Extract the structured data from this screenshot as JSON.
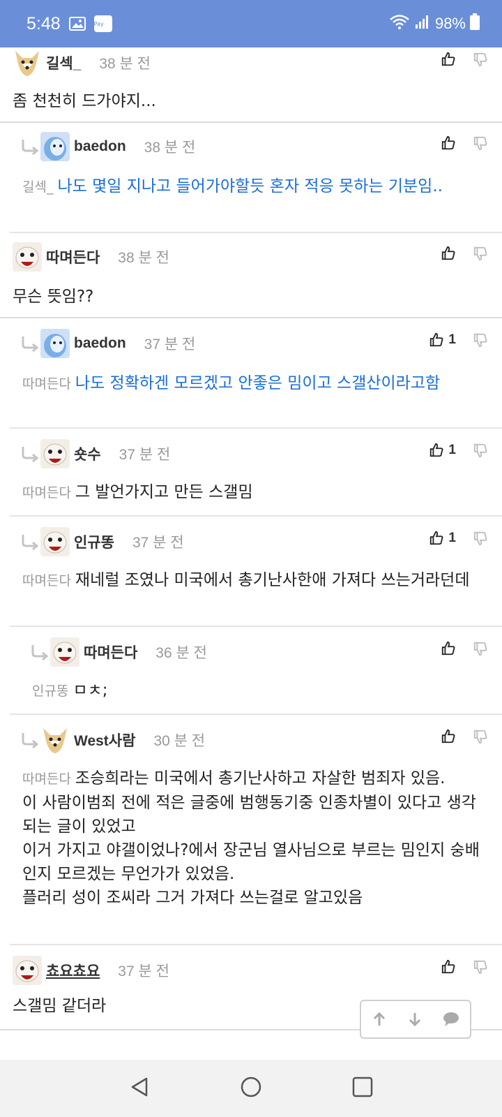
{
  "status_bar": {
    "time": "5:48",
    "pay_badge": "Pay",
    "battery": "98%",
    "bar_color": "#6a8fd8"
  },
  "accent_color": "#1a6ed8",
  "comments": [
    {
      "nick": "길섹_",
      "time": "38 분 전",
      "mention": "",
      "text": "좀 천천히 드가야지...",
      "up": "",
      "avatar": "dog-icon"
    },
    {
      "nick": "baedon",
      "time": "38 분 전",
      "mention": "길섹_",
      "text": "나도 몇일 지나고 들어가야할듯 혼자 적응 못하는 기분임..",
      "up": "",
      "avatar": "blue-face-icon"
    },
    {
      "nick": "따며든다",
      "time": "38 분 전",
      "mention": "",
      "text": "무슨 뜻임??",
      "up": "",
      "avatar": "red-face-icon"
    },
    {
      "nick": "baedon",
      "time": "37 분 전",
      "mention": "따며든다",
      "text": "나도 정확하겐 모르겠고 안좋은 밈이고 스갤산이라고함",
      "up": "1",
      "avatar": "blue-face-icon"
    },
    {
      "nick": "숏수",
      "time": "37 분 전",
      "mention": "따며든다",
      "text": "그 발언가지고 만든 스갤밈",
      "up": "1",
      "avatar": "red-face-icon"
    },
    {
      "nick": "인규똥",
      "time": "37 분 전",
      "mention": "따며든다",
      "text": "재네럴 조였나 미국에서 총기난사한애 가져다 쓰는거라던데",
      "up": "1",
      "avatar": "red-face-icon"
    },
    {
      "nick": "따며든다",
      "time": "36 분 전",
      "mention": "인규똥",
      "text": "ㅁㅊ;",
      "up": "",
      "avatar": "red-face-icon"
    },
    {
      "nick": "West사람",
      "time": "30 분 전",
      "mention": "따며든다",
      "text_lines": [
        "조승희라는 미국에서 총기난사하고 자살한 범죄자 있음.",
        "이 사람이범죄 전에 적은 글중에 범행동기중 인종차별이 있다고 생각되는 글이 있었고",
        "이거 가지고 야갤이었나?에서 장군님 열사님으로 부르는 밈인지 숭배인지 모르겠는 무언가가 있었음.",
        "플러리 성이 조씨라 그거 가져다 쓰는걸로 알고있음"
      ],
      "up": "",
      "avatar": "dog-icon"
    },
    {
      "nick": "쵸요쵸요",
      "time": "37 분 전",
      "mention": "",
      "text": "스갤밈 같더라",
      "up": "",
      "avatar": "red-face-icon"
    }
  ],
  "float_nav": [
    "arrow-up-icon",
    "arrow-down-icon",
    "comment-icon"
  ],
  "nav_bar": [
    "back-icon",
    "home-icon",
    "recents-icon"
  ]
}
